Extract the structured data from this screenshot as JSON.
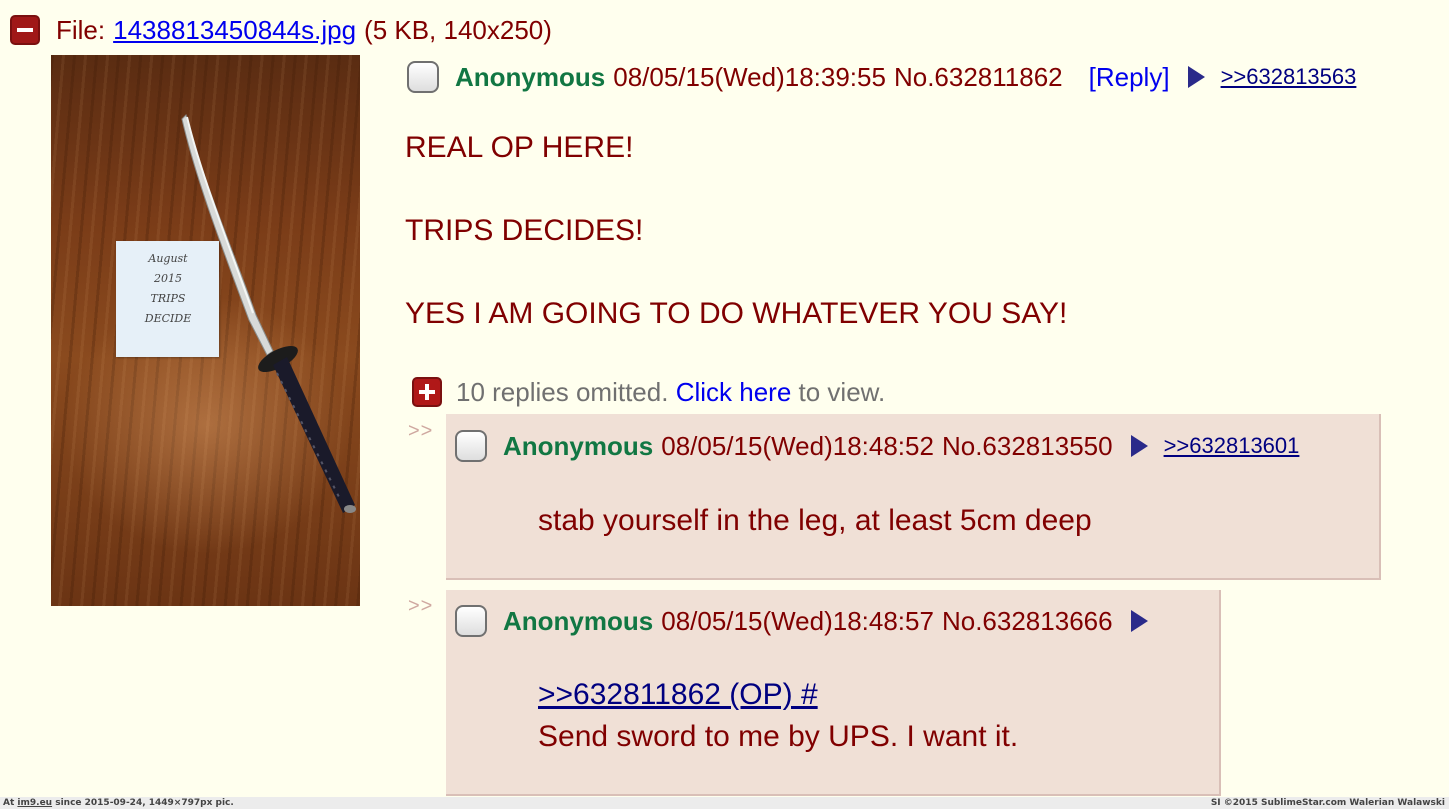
{
  "file": {
    "label": "File:",
    "filename": "1438813450844s.jpg",
    "info": "(5 KB, 140x250)"
  },
  "thumbnail": {
    "note_text": "August\n2015\nTRIPS\nDECIDE"
  },
  "op": {
    "name": "Anonymous",
    "datetime": "08/05/15(Wed)18:39:55",
    "postnum": "No.632811862",
    "reply_label": "[Reply]",
    "backlink": ">>632813563",
    "lines": [
      "REAL OP HERE!",
      "TRIPS DECIDES!",
      "YES I AM GOING TO DO WHATEVER YOU SAY!"
    ]
  },
  "omitted": {
    "prefix": "10 replies omitted.",
    "link": "Click here",
    "suffix": "to view."
  },
  "replies": [
    {
      "arrows": ">>",
      "name": "Anonymous",
      "datetime": "08/05/15(Wed)18:48:52",
      "postnum": "No.632813550",
      "backlink": ">>632813601",
      "text": "stab yourself in the leg, at least 5cm deep"
    },
    {
      "arrows": ">>",
      "name": "Anonymous",
      "datetime": "08/05/15(Wed)18:48:57",
      "postnum": "No.632813666",
      "quote": ">>632811862 (OP) #",
      "text": "Send sword to me by UPS. I want it."
    }
  ],
  "footer": {
    "left_prefix": "At",
    "site": "im9.eu",
    "left_suffix": "since 2015-09-24, 1449×797px pic.",
    "right": "SI ©2015 SublimeStar.com Walerian Walawski"
  },
  "colors": {
    "background": "#ffffee",
    "name": "#117743",
    "text": "#800000",
    "reply_bg": "#f0e0d6",
    "link": "#0000ee"
  }
}
